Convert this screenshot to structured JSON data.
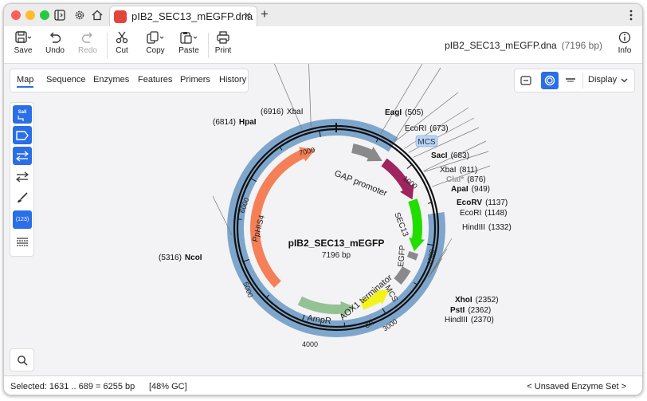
{
  "tab": {
    "filename": "pIB2_SEC13_mEGFP.dna",
    "close": "✕",
    "new": "+"
  },
  "toolbar": {
    "save": "Save",
    "undo": "Undo",
    "redo": "Redo",
    "cut": "Cut",
    "copy": "Copy",
    "paste": "Paste",
    "print": "Print",
    "info": "Info",
    "doc_name": "pIB2_SEC13_mEGFP.dna",
    "doc_length": "(7196 bp)"
  },
  "view_tabs": [
    "Map",
    "Sequence",
    "Enzymes",
    "Features",
    "Primers",
    "History"
  ],
  "active_view_tab": "Map",
  "display_button": "Display",
  "left_tools": {
    "sall_label": "SalI",
    "numbers_label": "(123)"
  },
  "map": {
    "name": "pIB2_SEC13_mEGFP",
    "length": "7196 bp",
    "ticks": [
      "1000",
      "2000",
      "3000",
      "4000",
      "5000",
      "6000",
      "7000"
    ],
    "features": [
      "GAP promoter",
      "SEC13",
      "EGFP",
      "MCS",
      "AOX1 terminator",
      "ori",
      "AmpR",
      "PpHIS4"
    ],
    "mcs_label": "MCS",
    "sites": [
      {
        "name": "EagI",
        "pos": "(505)"
      },
      {
        "name": "EcoRI",
        "pos": "(673)"
      },
      {
        "name": "SacI",
        "pos": "(683)"
      },
      {
        "name": "XbaI",
        "pos": "(811)"
      },
      {
        "name": "ClaI*",
        "pos": "(876)"
      },
      {
        "name": "ApaI",
        "pos": "(949)"
      },
      {
        "name": "EcoRV",
        "pos": "(1137)"
      },
      {
        "name": "EcoRI",
        "pos": "(1148)"
      },
      {
        "name": "HindIII",
        "pos": "(1332)"
      },
      {
        "name": "XhoI",
        "pos": "(2352)"
      },
      {
        "name": "PstI",
        "pos": "(2362)"
      },
      {
        "name": "HindIII",
        "pos": "(2370)"
      },
      {
        "name": "NcoI",
        "pos": "(5316)"
      },
      {
        "name": "HpaI",
        "pos": "(6814)"
      },
      {
        "name": "XbaI",
        "pos": "(6916)"
      }
    ]
  },
  "status": {
    "selected": "Selected:   1631 .. 689  =  6255 bp",
    "gc": "[48% GC]",
    "enzyme_set": "< Unsaved Enzyme Set >"
  },
  "colors": {
    "accent": "#2a6ee8",
    "selection": "#7ea6cc",
    "sec13": "#a0245e",
    "egfp": "#22dd00",
    "ori": "#f3f31c",
    "ampr": "#94c294",
    "his4": "#f58058",
    "gray": "#8a8a8a"
  }
}
